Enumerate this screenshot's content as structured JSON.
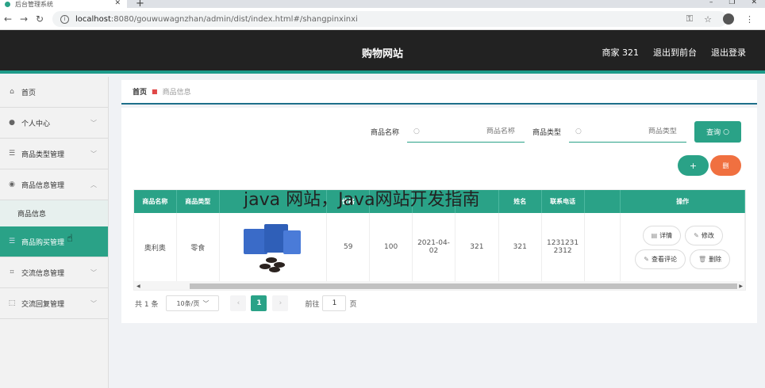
{
  "browser": {
    "tab_title": "后台管理系统",
    "url_host": "localhost",
    "url_rest": ":8080/gouwuwagnzhan/admin/dist/index.html#/shangpinxinxi"
  },
  "header": {
    "title": "购物网站",
    "user": "商家 321",
    "back_front": "退出到前台",
    "logout": "退出登录"
  },
  "sidebar": {
    "items": [
      {
        "label": "首页",
        "icon": "home-icon"
      },
      {
        "label": "个人中心",
        "icon": "user-icon"
      },
      {
        "label": "商品类型管理",
        "icon": "list-icon"
      },
      {
        "label": "商品信息管理",
        "icon": "pin-icon"
      },
      {
        "label": "商品信息",
        "icon": ""
      },
      {
        "label": "商品购买管理",
        "icon": "list-icon"
      },
      {
        "label": "交流信息管理",
        "icon": "crop-icon"
      },
      {
        "label": "交流回复管理",
        "icon": "frame-icon"
      }
    ]
  },
  "breadcrumb": {
    "home": "首页",
    "current": "商品信息"
  },
  "search": {
    "name_label": "商品名称",
    "name_placeholder": "商品名称",
    "type_label": "商品类型",
    "type_placeholder": "商品类型",
    "query_label": "查询"
  },
  "actions": {
    "add": "+",
    "delete": "删"
  },
  "table": {
    "headers": [
      "商品名称",
      "商品类型",
      "",
      "价格",
      "",
      "",
      "",
      "姓名",
      "联系电话",
      "",
      "操作"
    ],
    "row": {
      "name": "奥利奥",
      "type": "零食",
      "price": "59",
      "stock": "100",
      "date": "2021-04-02",
      "account": "321",
      "merchant": "321",
      "phone": "12312312312"
    },
    "ops": [
      "详情",
      "修改",
      "查看评论",
      "删除"
    ]
  },
  "pager": {
    "total": "共 1 条",
    "page_size": "10条/页",
    "current_page": "1",
    "goto_label": "前往",
    "goto_value": "1",
    "page_suffix": "页"
  },
  "overlay": {
    "watermark": "java 网站，Java网站开发指南"
  },
  "colors": {
    "primary": "#2aa287",
    "header_bg": "#222222",
    "danger": "#f07040"
  }
}
